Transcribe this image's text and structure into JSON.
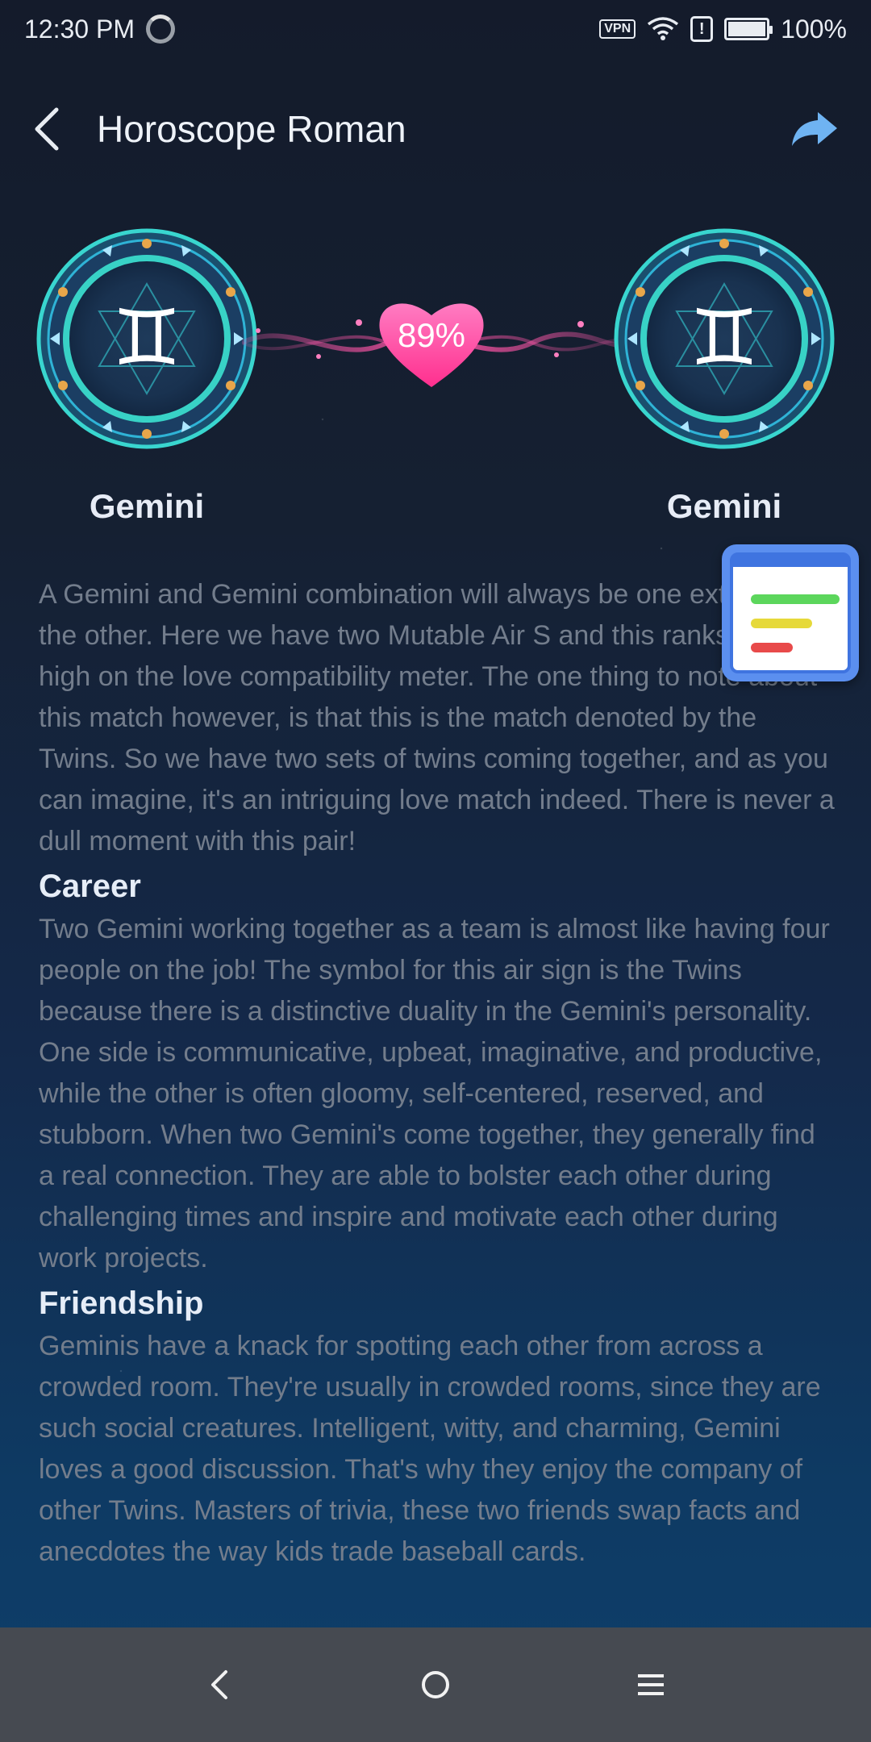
{
  "status_bar": {
    "time": "12:30 PM",
    "vpn_label": "VPN",
    "alert_symbol": "!",
    "battery_percent": "100%",
    "battery_level": 1.0
  },
  "header": {
    "title": "Horoscope Roman"
  },
  "compatibility": {
    "left_sign": "Gemini",
    "right_sign": "Gemini",
    "percent": "89%",
    "glyph": "♊"
  },
  "content": {
    "intro": "A Gemini and Gemini combination will always be one extreme or the other. Here we have two Mutable Air S and this ranks very high on the love compatibility meter. The one thing to note about this match however, is that this is the match denoted by the Twins. So we have two sets of twins coming together, and as you can imagine, it's an intriguing love match indeed. There is never a dull moment with this pair!",
    "career_title": "Career",
    "career_text": "Two Gemini working together as a team is almost like having four people on the job! The symbol for this air sign is the Twins because there is a distinctive duality in the Gemini's personality. One side is communicative, upbeat, imaginative, and productive, while the other is often gloomy, self-centered, reserved, and stubborn. When two Gemini's come together, they generally find a real connection. They are able to bolster each other during challenging times and inspire and motivate each other during work projects.",
    "friendship_title": "Friendship",
    "friendship_text": "Geminis have a knack for spotting each other from across a crowded room. They're usually in crowded rooms, since they are such social creatures. Intelligent, witty, and charming, Gemini loves a good discussion. That's why they enjoy the company of other Twins. Masters of trivia, these two friends swap facts and anecdotes the way kids trade baseball cards."
  },
  "icons": {
    "back": "back-arrow-icon",
    "share": "share-arrow-icon",
    "floating": "floating-window-icon"
  },
  "colors": {
    "accent_teal": "#2fd3c8",
    "heart_pink": "#ff4fa3",
    "floating_blue": "#5b8fef",
    "navbar": "#464a51"
  }
}
